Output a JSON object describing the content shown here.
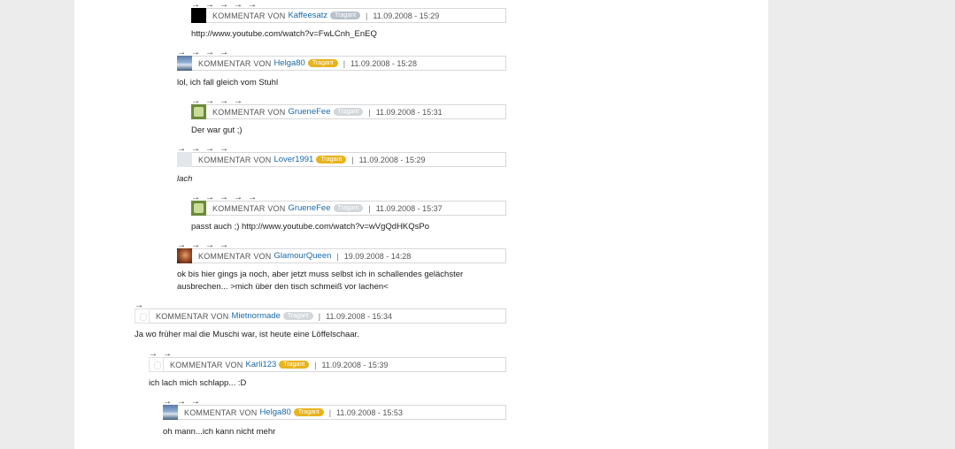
{
  "arrow_glyph": "→",
  "label_prefix": "KOMMENTAR VON",
  "comments": [
    {
      "user": "Kaffeesatz",
      "badge": "Tragant",
      "date": "11.09.2008 - 15:29",
      "text": "http://www.youtube.com/watch?v=FwLCnh_EnEQ",
      "avatar": "black-avatar",
      "depth_arrows": 5
    },
    {
      "user": "Helga80",
      "badge": "Tragant",
      "date": "11.09.2008 - 15:28",
      "text": "lol, ich fall gleich vom Stuhl",
      "avatar": "helga-avatar",
      "depth_arrows": 4
    },
    {
      "user": "GrueneFee",
      "badge": "Tragant",
      "date": "11.09.2008 - 15:31",
      "text": "Der war gut ;)",
      "avatar": "greenfee-avatar",
      "depth_arrows": 5
    },
    {
      "user": "Lover1991",
      "badge": "Tragant",
      "date": "11.09.2008 - 15:29",
      "text": "lach",
      "avatar": "lover-avatar",
      "depth_arrows": 4
    },
    {
      "user": "GrueneFee",
      "badge": "Tragant",
      "date": "11.09.2008 - 15:37",
      "text": "passt auch ;) http://www.youtube.com/watch?v=wVgQdHKQsPo",
      "avatar": "greenfee-avatar",
      "depth_arrows": 5
    },
    {
      "user": "GlamourQueen",
      "badge": "",
      "date": "19.09.2008 - 14:28",
      "text_line1": "ok bis hier gings ja noch, aber jetzt muss selbst ich in schallendes gelächster",
      "text_line2": "ausbrechen... >mich über den tisch schmeiß vor lachen<",
      "avatar": "glamour-avatar",
      "depth_arrows": 4
    },
    {
      "user": "Mietnormade",
      "badge": "Tragant",
      "date": "11.09.2008 - 15:34",
      "text": "Ja wo früher mal die Muschi war, ist heute eine Löffelschaar.",
      "avatar": "empty-avatar",
      "depth_arrows": 1
    },
    {
      "user": "Karli123",
      "badge": "Tragant",
      "date": "11.09.2008 - 15:39",
      "text": "ich lach mich schlapp... :D",
      "avatar": "empty-avatar",
      "depth_arrows": 2
    },
    {
      "user": "Helga80",
      "badge": "Tragant",
      "date": "11.09.2008 - 15:53",
      "text": "oh mann...ich kann nicht mehr",
      "avatar": "helga-avatar",
      "depth_arrows": 3
    }
  ],
  "separator": "|",
  "colors": {
    "user_link": "#1a6aa8",
    "badge_gold": "#e8b31b",
    "badge_gray": "#b8c2cc",
    "background": "#ececec",
    "panel": "#ffffff"
  }
}
